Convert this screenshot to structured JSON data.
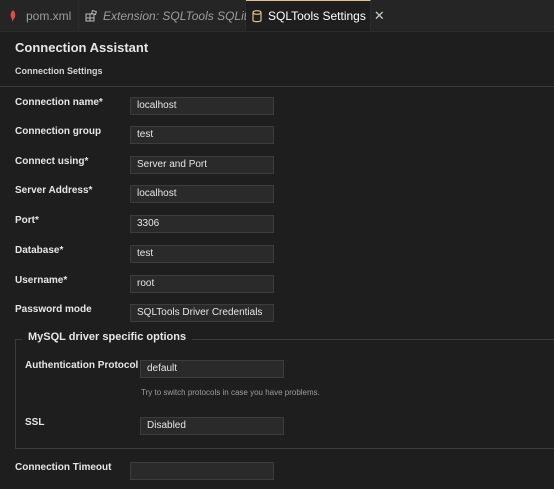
{
  "tabs": [
    {
      "label": "pom.xml",
      "icon": "maven-icon"
    },
    {
      "label": "Extension: SQLTools SQLite",
      "icon": "extension-icon"
    },
    {
      "label": "SQLTools Settings",
      "icon": "database-icon",
      "active": true
    }
  ],
  "page": {
    "title": "Connection Assistant",
    "subtitle": "Connection Settings"
  },
  "form": {
    "connection_name": {
      "label": "Connection name*",
      "value": "localhost"
    },
    "connection_group": {
      "label": "Connection group",
      "value": "test"
    },
    "connect_using": {
      "label": "Connect using*",
      "value": "Server and Port"
    },
    "server_address": {
      "label": "Server Address*",
      "value": "localhost"
    },
    "port": {
      "label": "Port*",
      "value": "3306"
    },
    "database": {
      "label": "Database*",
      "value": "test"
    },
    "username": {
      "label": "Username*",
      "value": "root"
    },
    "password_mode": {
      "label": "Password mode",
      "value": "SQLTools Driver Credentials"
    },
    "connection_timeout": {
      "label": "Connection Timeout",
      "value": ""
    }
  },
  "mysql": {
    "legend": "MySQL driver specific options",
    "auth_protocol": {
      "label": "Authentication Protocol",
      "value": "default"
    },
    "auth_hint": "Try to switch protocols in case you have problems.",
    "ssl": {
      "label": "SSL",
      "value": "Disabled"
    }
  },
  "colors": {
    "accent_tab_border": "#e2c08d",
    "background": "#1e1e1e",
    "field_bg": "#2a2a2a"
  }
}
